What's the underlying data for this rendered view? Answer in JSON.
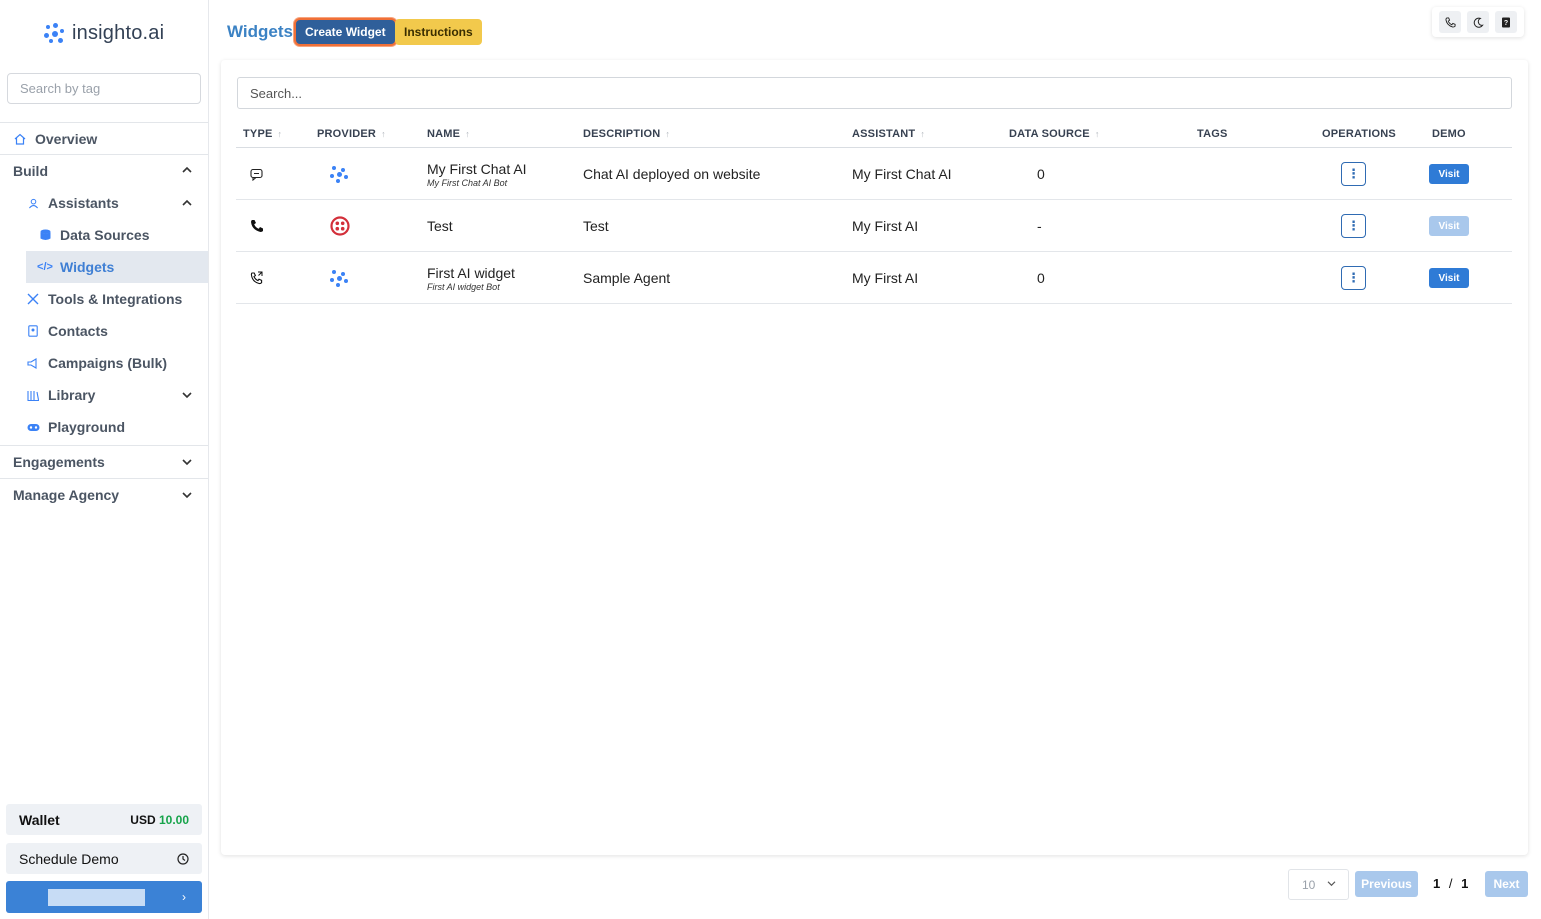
{
  "brand": {
    "name": "insighto.ai",
    "accent": "#3b82f6"
  },
  "sidebar": {
    "search_placeholder": "Search by tag",
    "overview": "Overview",
    "build": "Build",
    "assistants": "Assistants",
    "data_sources": "Data Sources",
    "widgets": "Widgets",
    "tools": "Tools & Integrations",
    "contacts": "Contacts",
    "campaigns": "Campaigns (Bulk)",
    "library": "Library",
    "playground": "Playground",
    "engagements": "Engagements",
    "manage_agency": "Manage Agency",
    "wallet_label": "Wallet",
    "wallet_currency": "USD",
    "wallet_amount": "10.00",
    "schedule_demo": "Schedule Demo"
  },
  "header": {
    "title": "Widgets",
    "create_label": "Create Widget",
    "instructions_label": "Instructions"
  },
  "table": {
    "search_placeholder": "Search...",
    "columns": {
      "type": "TYPE",
      "provider": "PROVIDER",
      "name": "NAME",
      "description": "DESCRIPTION",
      "assistant": "ASSISTANT",
      "data_source": "DATA SOURCE",
      "tags": "TAGS",
      "operations": "OPERATIONS",
      "demo": "DEMO"
    },
    "rows": [
      {
        "type_icon": "chat-icon",
        "provider_icon": "insighto-icon",
        "name": "My First Chat AI",
        "subname": "My First Chat AI Bot",
        "description": "Chat AI deployed on website",
        "assistant": "My First Chat AI",
        "data_source": "0",
        "tags": "",
        "visit": "Visit",
        "visit_enabled": true
      },
      {
        "type_icon": "phone-icon",
        "provider_icon": "twilio-icon",
        "name": "Test",
        "subname": "",
        "description": "Test",
        "assistant": "My First AI",
        "data_source": "-",
        "tags": "",
        "visit": "Visit",
        "visit_enabled": false
      },
      {
        "type_icon": "phone-call-icon",
        "provider_icon": "insighto-icon",
        "name": "First AI widget",
        "subname": "First AI widget Bot",
        "description": "Sample Agent",
        "assistant": "My First AI",
        "data_source": "0",
        "tags": "",
        "visit": "Visit",
        "visit_enabled": true
      }
    ]
  },
  "pagination": {
    "page_size": "10",
    "previous": "Previous",
    "current": "1",
    "separator": "/",
    "total": "1",
    "next": "Next"
  }
}
